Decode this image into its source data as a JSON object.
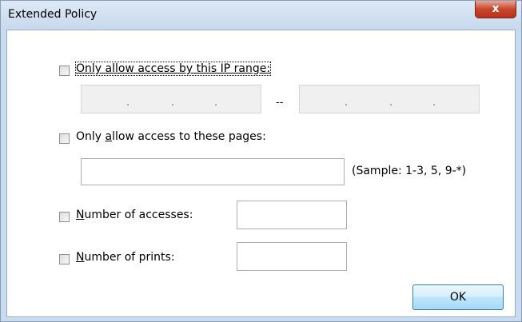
{
  "window": {
    "title": "Extended Policy",
    "close_glyph": "x"
  },
  "ip_range": {
    "label": "Only allow access by this IP range:",
    "checked": false,
    "separator": "--",
    "from_dots": [
      ".",
      ".",
      "."
    ],
    "to_dots": [
      ".",
      ".",
      "."
    ]
  },
  "pages": {
    "label_prefix": "Only ",
    "label_mnemonic": "a",
    "label_suffix": "llow access to these pages:",
    "checked": false,
    "value": "",
    "sample": "(Sample: 1-3, 5, 9-*)"
  },
  "accesses": {
    "label_mnemonic": "N",
    "label_suffix": "umber of accesses:",
    "checked": false,
    "value": ""
  },
  "prints": {
    "label_mnemonic": "N",
    "label_suffix": "umber of prints:",
    "checked": false,
    "value": ""
  },
  "buttons": {
    "ok_label": "OK"
  },
  "colors": {
    "titlebar": "#c7d9ed",
    "close_button": "#c9452c",
    "ok_border": "#3c7fb1"
  }
}
